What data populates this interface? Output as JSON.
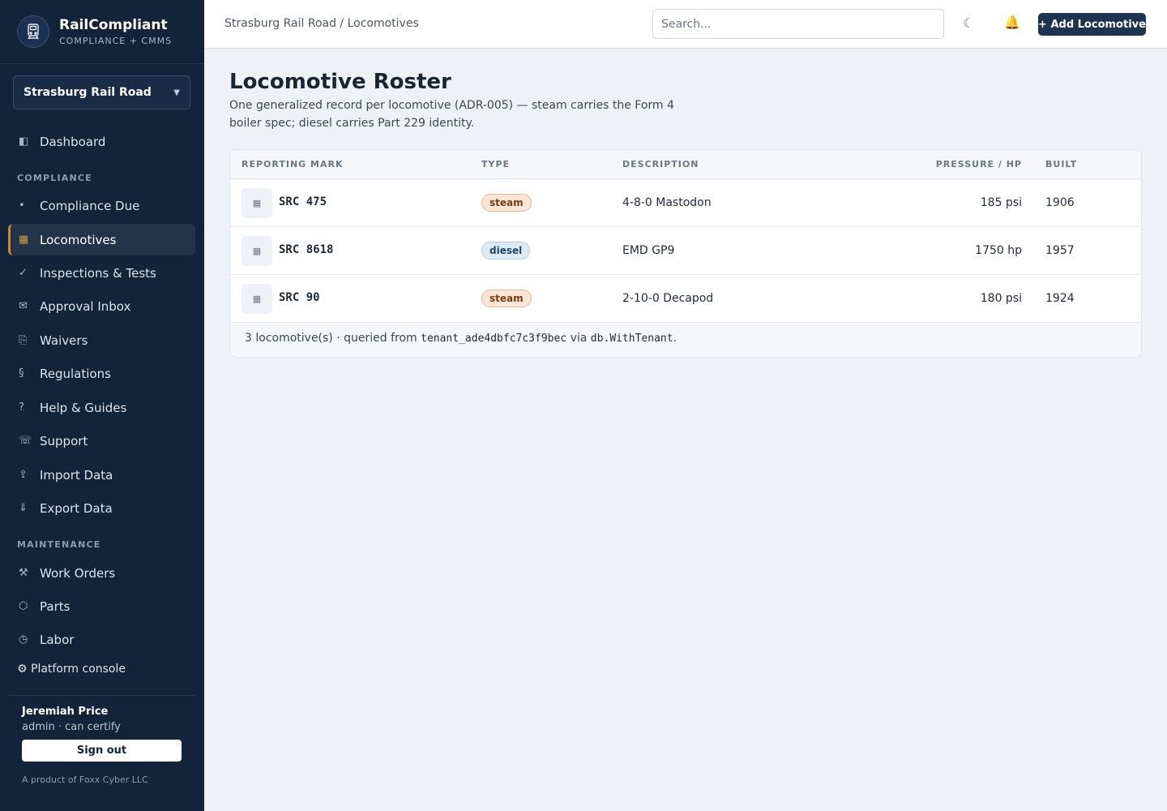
{
  "brand": {
    "name": "RailCompliant",
    "subtitle": "COMPLIANCE + CMMS"
  },
  "tenant": {
    "selected": "Strasburg Rail Road"
  },
  "nav": {
    "dashboard": {
      "label": "Dashboard",
      "icon": "dashboard-icon",
      "glyph": "◧"
    },
    "compliance_section": "COMPLIANCE",
    "compliance_items": [
      {
        "label": "Compliance Due",
        "glyph": "•"
      },
      {
        "label": "Locomotives",
        "glyph": "▦",
        "active": true
      },
      {
        "label": "Inspections & Tests",
        "glyph": "✓"
      },
      {
        "label": "Approval Inbox",
        "glyph": "✉"
      },
      {
        "label": "Waivers",
        "glyph": "⎘"
      },
      {
        "label": "Regulations",
        "glyph": "§"
      },
      {
        "label": "Help & Guides",
        "glyph": "?"
      },
      {
        "label": "Support",
        "glyph": "☏"
      },
      {
        "label": "Import Data",
        "glyph": "⇪"
      },
      {
        "label": "Export Data",
        "glyph": "⇓"
      }
    ],
    "maintenance_section": "MAINTENANCE",
    "maintenance_items": [
      {
        "label": "Work Orders",
        "glyph": "⚒"
      },
      {
        "label": "Parts",
        "glyph": "⬡"
      },
      {
        "label": "Labor",
        "glyph": "◷"
      }
    ],
    "platform_console": "⚙ Platform console"
  },
  "user": {
    "name": "Jeremiah Price",
    "role": "admin · can certify",
    "sign_out": "Sign out",
    "product": "A product of Foxx Cyber LLC"
  },
  "topbar": {
    "breadcrumb": "Strasburg Rail Road / Locomotives",
    "search_placeholder": "Search...",
    "theme_glyph": "☾",
    "bell_glyph": "🔔",
    "add_button": "+ Add Locomotive"
  },
  "page": {
    "title": "Locomotive Roster",
    "description": "One generalized record per locomotive (ADR-005) — steam carries the Form 4 boiler spec; diesel carries Part 229 identity."
  },
  "table": {
    "headers": {
      "mark": "REPORTING MARK",
      "type": "TYPE",
      "description": "DESCRIPTION",
      "pressure": "PRESSURE / HP",
      "built": "BUILT"
    },
    "rows": [
      {
        "mark": "SRC 475",
        "type": "steam",
        "description": "4-8-0 Mastodon",
        "pressure": "185 psi",
        "built": "1906"
      },
      {
        "mark": "SRC 8618",
        "type": "diesel",
        "description": "EMD GP9",
        "pressure": "1750 hp",
        "built": "1957"
      },
      {
        "mark": "SRC 90",
        "type": "steam",
        "description": "2-10-0 Decapod",
        "pressure": "180 psi",
        "built": "1924"
      }
    ],
    "thumb_glyph": "▦",
    "footer": {
      "count_text": "3 locomotive(s) · queried from ",
      "tenant_code": "tenant_ade4dbfc7c3f9bec",
      "via_text": " via ",
      "fn_code": "db.WithTenant",
      "end": "."
    }
  },
  "colors": {
    "sidebar_bg": "#13233a",
    "accent": "#c98a2a",
    "primary_button": "#1d3350",
    "steam_badge": "#fbe6d6",
    "diesel_badge": "#deeaf6"
  }
}
